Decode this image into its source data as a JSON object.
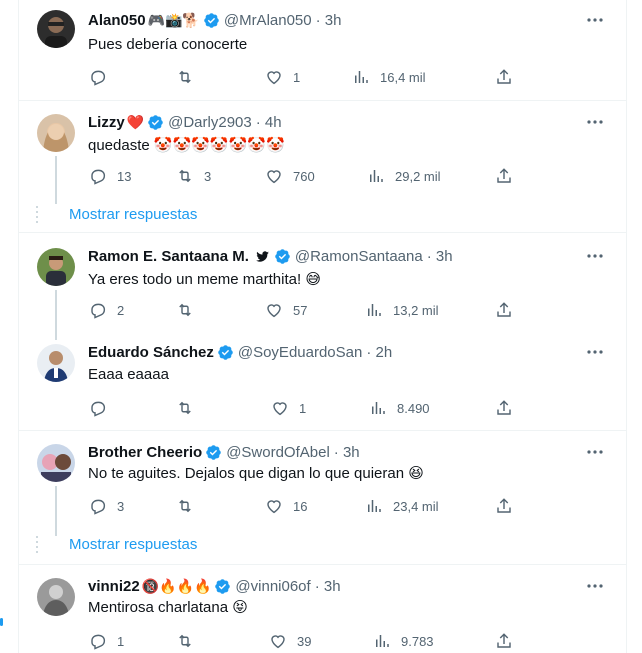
{
  "colors": {
    "accent": "#1d9bf0",
    "secondary_text": "#536471",
    "separator": "#eff3f4"
  },
  "show_replies_label": "Mostrar respuestas",
  "tweets": [
    {
      "name": "Alan050",
      "name_emojis": "🎮📸🐕",
      "handle": "@MrAlan050",
      "time": "· 3h",
      "text": "Pues debería conocerte",
      "replies": "",
      "retweets": "",
      "likes": "1",
      "views": "16,4 mil"
    },
    {
      "name": "Lizzy",
      "name_emojis": "❤️",
      "handle": "@Darly2903",
      "time": "· 4h",
      "text": "quedaste 🤡🤡🤡🤡🤡🤡🤡",
      "replies": "13",
      "retweets": "3",
      "likes": "760",
      "views": "29,2 mil"
    },
    {
      "name": "Ramon E. Santaana M.",
      "name_emojis": "🐦",
      "handle": "@RamonSantaana",
      "time": "· 3h",
      "text": "Ya eres todo un meme marthita! 😅",
      "replies": "2",
      "retweets": "",
      "likes": "57",
      "views": "13,2 mil"
    },
    {
      "name": "Eduardo Sánchez",
      "name_emojis": "",
      "handle": "@SoyEduardoSan",
      "time": "· 2h",
      "text": "Eaaa eaaaa",
      "replies": "",
      "retweets": "",
      "likes": "1",
      "views": "8.490"
    },
    {
      "name": "Brother Cheerio",
      "name_emojis": "",
      "handle": "@SwordOfAbel",
      "time": "· 3h",
      "text": "No te aguites. Dejalos que digan lo que quieran 😆",
      "replies": "3",
      "retweets": "",
      "likes": "16",
      "views": "23,4 mil"
    },
    {
      "name": "vinni22",
      "name_emojis": "🔞🔥🔥🔥",
      "handle": "@vinni06of",
      "time": "· 3h",
      "text": "Mentirosa charlatana 😝",
      "replies": "1",
      "retweets": "",
      "likes": "39",
      "views": "9.783"
    }
  ]
}
